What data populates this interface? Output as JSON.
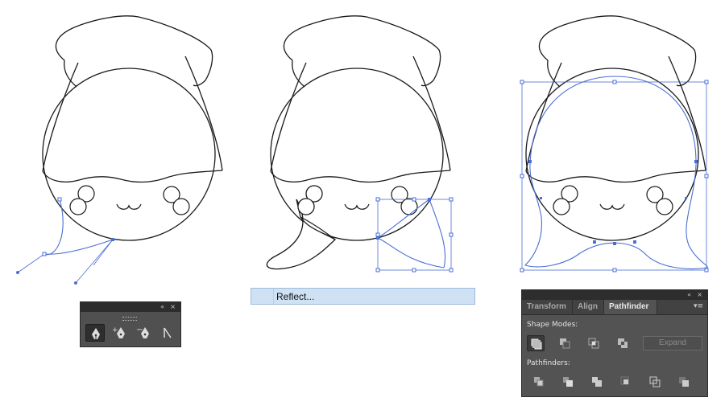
{
  "pen_tools_panel": {
    "collapse_icon": "«",
    "close_icon": "×",
    "tools": [
      {
        "icon": "pen-icon",
        "selected": true
      },
      {
        "icon": "add-anchor-point-icon",
        "selected": false
      },
      {
        "icon": "delete-anchor-point-icon",
        "selected": false
      },
      {
        "icon": "convert-anchor-point-icon",
        "selected": false
      }
    ]
  },
  "context_menu": {
    "items": [
      {
        "label": "Reflect...",
        "highlighted": true
      }
    ]
  },
  "pathfinder_panel": {
    "collapse_icon": "«",
    "close_icon": "×",
    "menu_icon": "▾≡",
    "tabs": [
      {
        "label": "Transform",
        "active": false
      },
      {
        "label": "Align",
        "active": false
      },
      {
        "label": "Pathfinder",
        "active": true
      }
    ],
    "shape_modes_label": "Shape Modes:",
    "shape_modes": [
      "unite-icon",
      "minus-front-icon",
      "intersect-icon",
      "exclude-icon"
    ],
    "expand_label": "Expand",
    "pathfinders_label": "Pathfinders:",
    "pathfinders": [
      "divide-icon",
      "trim-icon",
      "merge-icon",
      "crop-icon",
      "outline-icon",
      "minus-back-icon"
    ]
  },
  "colors": {
    "selection": "#4a6fd4",
    "panel_bg": "#535353",
    "menu_highlight": "#cfe2f4"
  }
}
